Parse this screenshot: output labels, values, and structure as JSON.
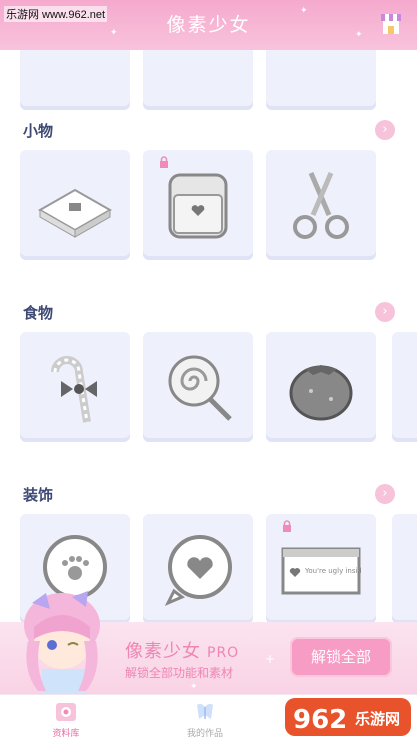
{
  "watermark": "乐游网 www.962.net",
  "header": {
    "title": "像素少女"
  },
  "categories": [
    {
      "title": "小物",
      "items": [
        "gift-box",
        "school-bag",
        "scissors"
      ],
      "locked": [
        false,
        true,
        false
      ]
    },
    {
      "title": "食物",
      "items": [
        "candy-cane",
        "lollipop",
        "persimmon"
      ],
      "locked": [
        false,
        false,
        false
      ]
    },
    {
      "title": "装饰",
      "items": [
        "paw-bubble",
        "heart-bubble",
        "message-window"
      ],
      "locked": [
        false,
        false,
        true
      ]
    }
  ],
  "message_window_text": "You're ugly inside!",
  "promo": {
    "title": "像素少女",
    "badge": "PRO",
    "subtitle": "解锁全部功能和素材",
    "button": "解锁全部"
  },
  "tabs": [
    {
      "label": "资料库"
    },
    {
      "label": "我的作品"
    }
  ],
  "logo": {
    "text": "962",
    "sub": "乐游网"
  },
  "colors": {
    "brand_pink": "#f5a9cd",
    "accent": "#f69cc5",
    "tile": "#eef0fb"
  }
}
